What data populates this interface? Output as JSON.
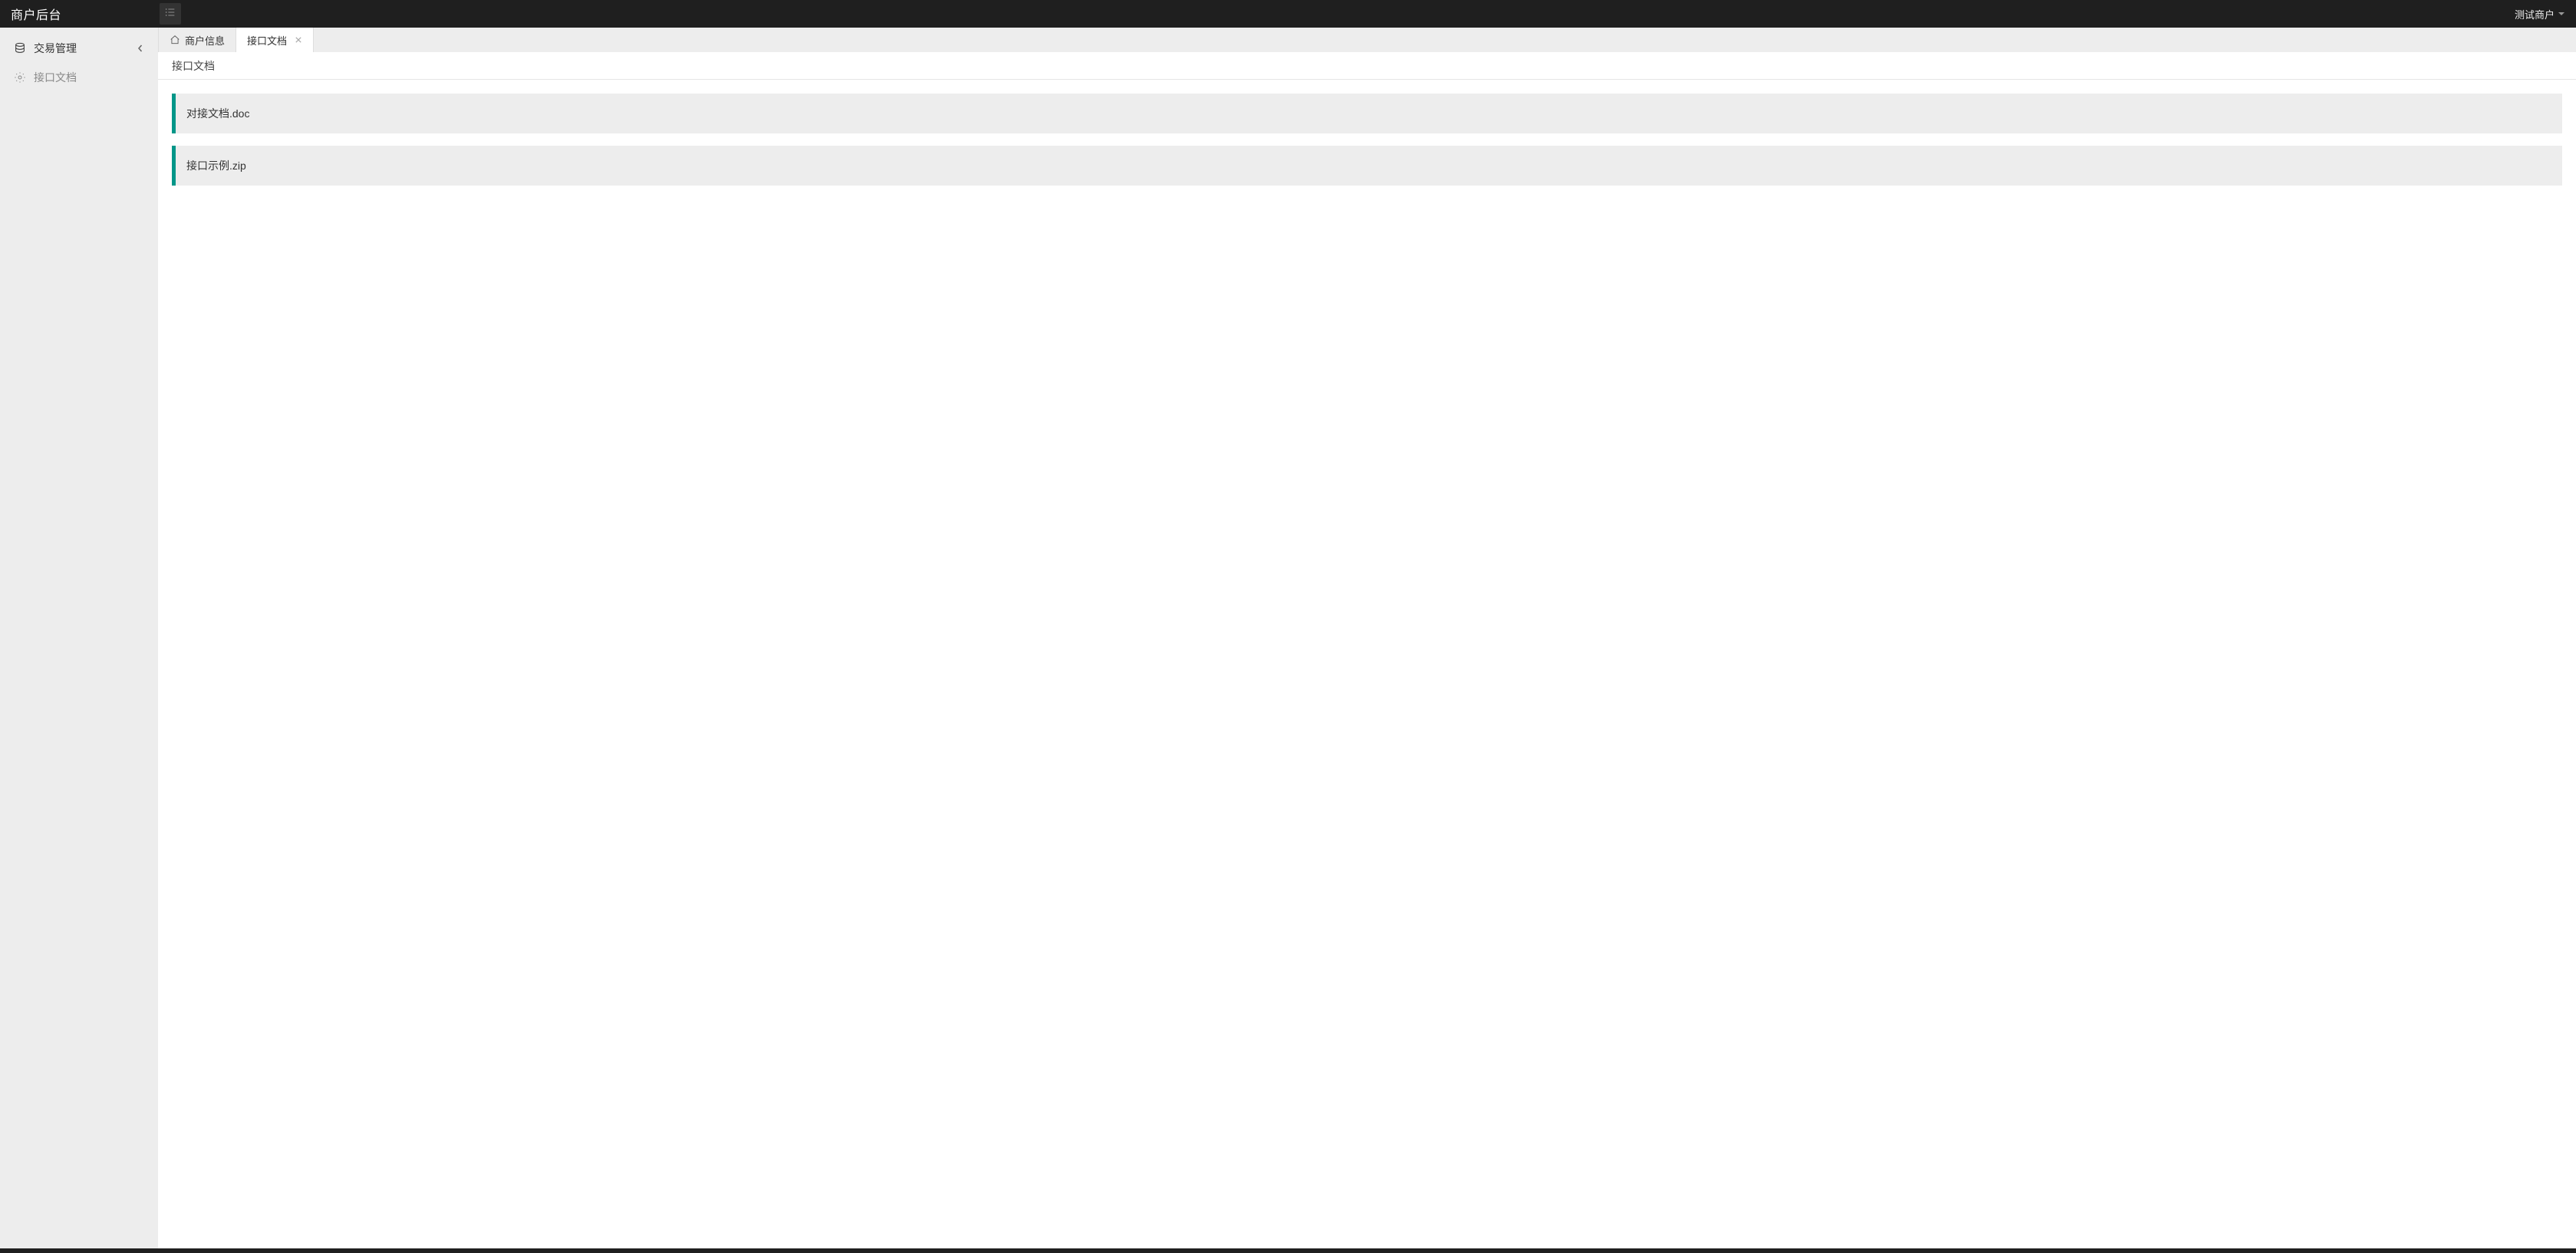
{
  "header": {
    "title": "商户后台",
    "user_name": "测试商户"
  },
  "sidebar": {
    "items": [
      {
        "label": "交易管理",
        "has_chevron": true
      },
      {
        "label": "接口文档",
        "has_chevron": false
      }
    ]
  },
  "tabs": [
    {
      "label": "商户信息",
      "active": false,
      "closable": false,
      "has_home_icon": true
    },
    {
      "label": "接口文档",
      "active": true,
      "closable": true,
      "has_home_icon": false
    }
  ],
  "breadcrumb": "接口文档",
  "documents": [
    {
      "name": "对接文档.doc"
    },
    {
      "name": "接口示例.zip"
    }
  ]
}
